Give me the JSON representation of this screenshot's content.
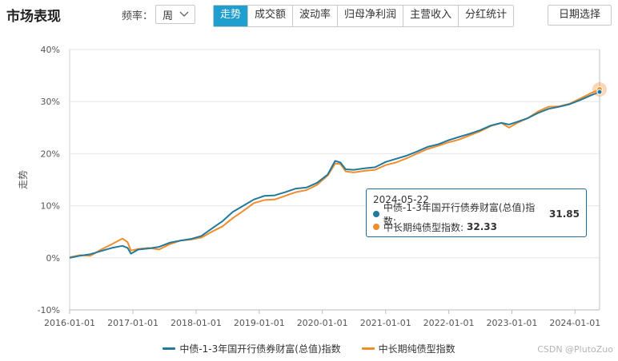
{
  "header": {
    "title": "市场表现",
    "freq_label": "频率：",
    "freq_value": "周",
    "tabs": [
      "走势",
      "成交额",
      "波动率",
      "归母净利润",
      "主营收入",
      "分红统计"
    ],
    "active_tab": 0,
    "date_button": "日期选择"
  },
  "colors": {
    "series1": "#21799b",
    "series2": "#f18d2c",
    "accent": "#1f9fd0"
  },
  "tooltip": {
    "date": "2024-05-22",
    "rows": [
      {
        "name": "中债-1-3年国开行债券财富(总值)指数:",
        "value": "31.85"
      },
      {
        "name": "中长期纯债型指数:",
        "value": "32.33"
      }
    ]
  },
  "watermark": "CSDN @PlutoZuo",
  "chart_data": {
    "type": "line",
    "ylabel": "走势",
    "ylim": [
      -10,
      40
    ],
    "yticks": [
      "-10%",
      "0%",
      "10%",
      "20%",
      "30%",
      "40%"
    ],
    "xlim": [
      "2016-01-01",
      "2024-05-22"
    ],
    "xticks": [
      "2016-01-01",
      "2017-01-01",
      "2018-01-01",
      "2019-01-01",
      "2020-01-01",
      "2021-01-01",
      "2022-01-01",
      "2023-01-01",
      "2024-01-01"
    ],
    "grid": true,
    "legend_position": "bottom",
    "series": [
      {
        "name": "中债-1-3年国开行债券财富(总值)指数",
        "color": "#21799b",
        "points": [
          [
            "2016-01-01",
            0.0
          ],
          [
            "2016-03-01",
            0.4
          ],
          [
            "2016-05-01",
            0.7
          ],
          [
            "2016-07-01",
            1.3
          ],
          [
            "2016-09-01",
            1.9
          ],
          [
            "2016-11-01",
            2.3
          ],
          [
            "2016-12-01",
            1.9
          ],
          [
            "2016-12-20",
            0.8
          ],
          [
            "2017-02-01",
            1.6
          ],
          [
            "2017-04-01",
            1.8
          ],
          [
            "2017-06-01",
            2.1
          ],
          [
            "2017-08-01",
            2.9
          ],
          [
            "2017-10-01",
            3.3
          ],
          [
            "2017-12-01",
            3.6
          ],
          [
            "2018-02-01",
            4.2
          ],
          [
            "2018-04-01",
            5.6
          ],
          [
            "2018-06-01",
            7.0
          ],
          [
            "2018-08-01",
            8.8
          ],
          [
            "2018-10-01",
            10.0
          ],
          [
            "2018-12-01",
            11.2
          ],
          [
            "2019-02-01",
            11.9
          ],
          [
            "2019-04-01",
            12.0
          ],
          [
            "2019-06-01",
            12.6
          ],
          [
            "2019-08-01",
            13.3
          ],
          [
            "2019-10-01",
            13.5
          ],
          [
            "2019-12-01",
            14.4
          ],
          [
            "2020-02-01",
            16.0
          ],
          [
            "2020-03-15",
            18.6
          ],
          [
            "2020-04-15",
            18.3
          ],
          [
            "2020-05-15",
            17.0
          ],
          [
            "2020-07-01",
            16.9
          ],
          [
            "2020-09-01",
            17.2
          ],
          [
            "2020-11-01",
            17.4
          ],
          [
            "2021-01-01",
            18.4
          ],
          [
            "2021-03-01",
            19.0
          ],
          [
            "2021-05-01",
            19.6
          ],
          [
            "2021-07-01",
            20.4
          ],
          [
            "2021-09-01",
            21.3
          ],
          [
            "2021-11-01",
            21.8
          ],
          [
            "2022-01-01",
            22.6
          ],
          [
            "2022-03-01",
            23.2
          ],
          [
            "2022-05-01",
            23.8
          ],
          [
            "2022-07-01",
            24.5
          ],
          [
            "2022-09-01",
            25.4
          ],
          [
            "2022-11-01",
            25.9
          ],
          [
            "2022-12-15",
            25.6
          ],
          [
            "2023-02-01",
            26.1
          ],
          [
            "2023-04-01",
            26.8
          ],
          [
            "2023-06-01",
            27.8
          ],
          [
            "2023-08-01",
            28.6
          ],
          [
            "2023-10-01",
            29.0
          ],
          [
            "2023-12-01",
            29.5
          ],
          [
            "2024-02-01",
            30.3
          ],
          [
            "2024-04-01",
            31.2
          ],
          [
            "2024-05-22",
            31.85
          ]
        ]
      },
      {
        "name": "中长期纯债型指数",
        "color": "#f18d2c",
        "points": [
          [
            "2016-01-01",
            0.1
          ],
          [
            "2016-03-01",
            0.5
          ],
          [
            "2016-05-01",
            0.4
          ],
          [
            "2016-07-01",
            1.6
          ],
          [
            "2016-09-01",
            2.6
          ],
          [
            "2016-11-01",
            3.7
          ],
          [
            "2016-12-01",
            3.0
          ],
          [
            "2016-12-20",
            1.4
          ],
          [
            "2017-02-01",
            1.7
          ],
          [
            "2017-04-01",
            1.9
          ],
          [
            "2017-06-01",
            1.6
          ],
          [
            "2017-08-01",
            2.6
          ],
          [
            "2017-10-01",
            3.3
          ],
          [
            "2017-12-01",
            3.5
          ],
          [
            "2018-02-01",
            3.9
          ],
          [
            "2018-04-01",
            5.0
          ],
          [
            "2018-06-01",
            6.0
          ],
          [
            "2018-08-01",
            7.6
          ],
          [
            "2018-10-01",
            9.0
          ],
          [
            "2018-12-01",
            10.5
          ],
          [
            "2019-02-01",
            11.1
          ],
          [
            "2019-04-01",
            11.2
          ],
          [
            "2019-06-01",
            11.9
          ],
          [
            "2019-08-01",
            12.6
          ],
          [
            "2019-10-01",
            13.0
          ],
          [
            "2019-12-01",
            14.0
          ],
          [
            "2020-02-01",
            15.8
          ],
          [
            "2020-03-15",
            18.1
          ],
          [
            "2020-04-15",
            18.0
          ],
          [
            "2020-05-15",
            16.6
          ],
          [
            "2020-07-01",
            16.4
          ],
          [
            "2020-09-01",
            16.7
          ],
          [
            "2020-11-01",
            16.9
          ],
          [
            "2021-01-01",
            17.8
          ],
          [
            "2021-03-01",
            18.3
          ],
          [
            "2021-05-01",
            19.1
          ],
          [
            "2021-07-01",
            20.0
          ],
          [
            "2021-09-01",
            20.9
          ],
          [
            "2021-11-01",
            21.5
          ],
          [
            "2022-01-01",
            22.2
          ],
          [
            "2022-03-01",
            22.7
          ],
          [
            "2022-05-01",
            23.5
          ],
          [
            "2022-07-01",
            24.3
          ],
          [
            "2022-09-01",
            25.3
          ],
          [
            "2022-11-01",
            25.9
          ],
          [
            "2022-12-15",
            25.0
          ],
          [
            "2023-02-01",
            25.9
          ],
          [
            "2023-04-01",
            26.8
          ],
          [
            "2023-06-01",
            28.1
          ],
          [
            "2023-08-01",
            29.0
          ],
          [
            "2023-10-01",
            29.1
          ],
          [
            "2023-12-01",
            29.6
          ],
          [
            "2024-02-01",
            30.6
          ],
          [
            "2024-04-01",
            31.6
          ],
          [
            "2024-05-22",
            32.33
          ]
        ]
      }
    ]
  }
}
